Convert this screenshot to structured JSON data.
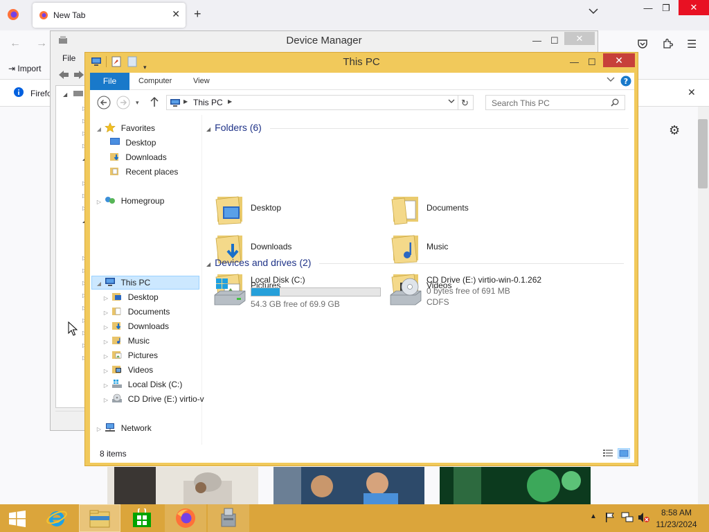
{
  "firefox": {
    "tab_title": "New Tab",
    "nav": {
      "import_label": "Import"
    },
    "notice": {
      "text": "Firefo"
    }
  },
  "device_manager": {
    "title": "Device Manager",
    "menu_file": "File"
  },
  "explorer": {
    "title": "This PC",
    "ribbon_tabs": [
      "File",
      "Computer",
      "View"
    ],
    "address_path": "This PC",
    "search_placeholder": "Search This PC",
    "nav": {
      "favorites": "Favorites",
      "favorites_items": [
        "Desktop",
        "Downloads",
        "Recent places"
      ],
      "homegroup": "Homegroup",
      "this_pc": "This PC",
      "this_pc_items": [
        "Desktop",
        "Documents",
        "Downloads",
        "Music",
        "Pictures",
        "Videos",
        "Local Disk (C:)",
        "CD Drive (E:) virtio-v"
      ],
      "network": "Network"
    },
    "folders_header": "Folders (6)",
    "folders": [
      "Desktop",
      "Documents",
      "Downloads",
      "Music",
      "Pictures",
      "Videos"
    ],
    "drives_header": "Devices and drives (2)",
    "drives": [
      {
        "name": "Local Disk (C:)",
        "free": "54.3 GB free of 69.9 GB",
        "used_fraction": 0.22
      },
      {
        "name": "CD Drive (E:) virtio-win-0.1.262",
        "free": "0 bytes free of 691 MB",
        "fs": "CDFS"
      }
    ],
    "status": "8 items"
  },
  "taskbar": {
    "time": "8:58 AM",
    "date": "11/23/2024"
  },
  "colors": {
    "explorer_frame": "#f1c95b",
    "taskbar": "#dba53b",
    "file_tab": "#1979ca",
    "close_red": "#c7403a",
    "drive_bar": "#26a0da"
  }
}
